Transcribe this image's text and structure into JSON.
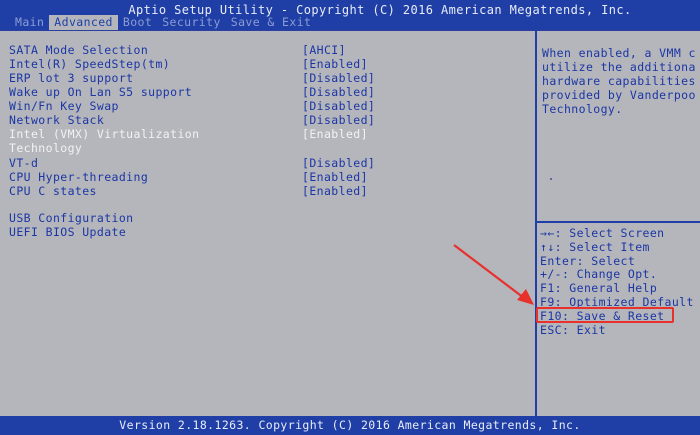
{
  "header": {
    "title": "Aptio Setup Utility - Copyright (C) 2016 American Megatrends, Inc.",
    "tabs": [
      {
        "label": "Main"
      },
      {
        "label": "Advanced"
      },
      {
        "label": "Boot"
      },
      {
        "label": "Security"
      },
      {
        "label": "Save & Exit"
      }
    ]
  },
  "settings": [
    {
      "label": "SATA Mode Selection",
      "value": "[AHCI]"
    },
    {
      "label": "Intel(R) SpeedStep(tm)",
      "value": "[Enabled]"
    },
    {
      "label": "ERP lot 3 support",
      "value": "[Disabled]"
    },
    {
      "label": "Wake up On Lan S5 support",
      "value": "[Disabled]"
    },
    {
      "label": "Win/Fn Key Swap",
      "value": "[Disabled]"
    },
    {
      "label": "Network Stack",
      "value": "[Disabled]"
    },
    {
      "label": "Intel (VMX) Virtualization",
      "value": "[Enabled]"
    },
    {
      "label": "Technology"
    },
    {
      "label": "VT-d",
      "value": "[Disabled]"
    },
    {
      "label": "CPU Hyper-threading",
      "value": "[Enabled]"
    },
    {
      "label": "CPU C states",
      "value": "[Enabled]"
    },
    {
      "label": "USB Configuration"
    },
    {
      "label": "UEFI BIOS Update"
    }
  ],
  "help_text": [
    "When enabled, a VMM c",
    "utilize the additiona",
    "hardware capabilities",
    "provided by Vanderpoo",
    "Technology."
  ],
  "key_help": [
    "→←: Select Screen",
    "↑↓: Select Item",
    "Enter: Select",
    "+/-: Change Opt.",
    "F1: General Help",
    "F9: Optimized Default",
    "F10: Save & Reset",
    "ESC: Exit"
  ],
  "footer": {
    "text": "Version 2.18.1263. Copyright (C) 2016 American Megatrends, Inc."
  },
  "colors": {
    "bios_blue": "#1f3fa6",
    "background_gray": "#b4b6bc",
    "highlight_red": "#e8302d",
    "selected_text": "#f2f2f2"
  }
}
